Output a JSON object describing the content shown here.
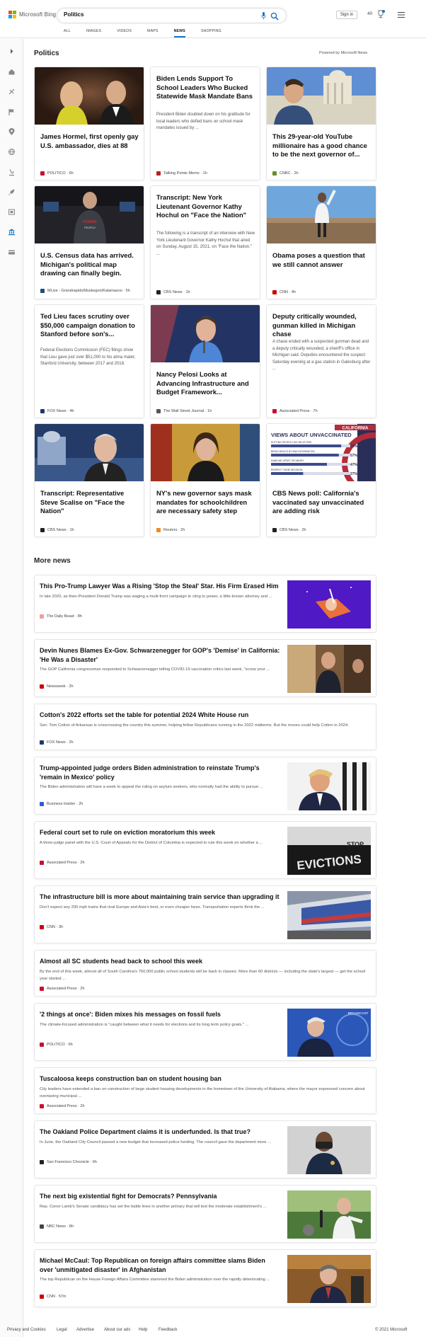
{
  "header": {
    "brand": "Microsoft Bing",
    "search_value": "Politics",
    "sign_in": "Sign in",
    "points": "40",
    "tabs": [
      {
        "label": "ALL"
      },
      {
        "label": "IMAGES"
      },
      {
        "label": "VIDEOS"
      },
      {
        "label": "MAPS"
      },
      {
        "label": "NEWS"
      },
      {
        "label": "SHOPPING"
      }
    ],
    "active_tab": "NEWS"
  },
  "colors": {
    "accent": "#1a73c9",
    "rail": "#fafafa",
    "border": "#e6e6e6"
  },
  "rail_icons": [
    "chevron-right-icon",
    "home-icon",
    "tools-icon",
    "flag-icon",
    "location-icon",
    "globe-icon",
    "microscope-icon",
    "rocket-icon",
    "film-icon",
    "bank-icon",
    "credit-card-icon"
  ],
  "politics": {
    "title": "Politics",
    "powered_by": "Powered by Microsoft News",
    "cards": [
      {
        "title": "James Hormel, first openly gay U.S. ambassador, dies at 88",
        "snippet": "",
        "source": "POLITICO",
        "age": "6h",
        "fav": "#c8102e"
      },
      {
        "title": "Biden Lends Support To School Leaders Who Bucked Statewide Mask Mandate Bans",
        "snippet": "President Biden doubled down on his gratitude for local leaders who defied bans on school mask mandates issued by ...",
        "source": "Talking Points Memo",
        "age": "1h",
        "fav": "#b22222"
      },
      {
        "title": "This 29-year-old YouTube millionaire has a good chance to be the next governor of...",
        "snippet": "",
        "source": "CNBC",
        "age": "2h",
        "fav": "#6b8e23"
      },
      {
        "title": "U.S. Census data has arrived. Michigan's political map drawing can finally begin.",
        "snippet": "",
        "source": "MLive - Grandrapids/Muskegon/Kalamazoo",
        "age": "5h",
        "fav": "#1f4e79"
      },
      {
        "title": "Transcript: New York Lieutenant Governor Kathy Hochul on \"Face the Nation\"",
        "snippet": "The following is a transcript of an interview with New York Lieutenant Governor Kathy Hochul that aired on Sunday, August 15, 2021, on \"Face the Nation.\" ...",
        "source": "CBS News",
        "age": "1h",
        "fav": "#222"
      },
      {
        "title": "Obama poses a question that we still cannot answer",
        "snippet": "",
        "source": "CNN",
        "age": "4h",
        "fav": "#cc0000"
      },
      {
        "title": "Ted Lieu faces scrutiny over $50,000 campaign donation to Stanford before son's...",
        "snippet": "Federal Elections Commission (FEC) filings show that Lieu gave just over $51,000 to his alma mater, Stanford University, between 2017 and 2018.",
        "source": "FOX News",
        "age": "4h",
        "fav": "#1b3a6b"
      },
      {
        "title": "Nancy Pelosi Looks at Advancing Infrastructure and Budget Framework...",
        "snippet": "",
        "source": "The Wall Street Journal",
        "age": "1h",
        "fav": "#555"
      },
      {
        "title": "Deputy critically wounded, gunman killed in Michigan chase",
        "snippet": "A chase ended with a suspected gunman dead and a deputy critically wounded, a sheriff's office in Michigan said. Deputies encountered the suspect Saturday evening at a gas station in Galesburg after ...",
        "source": "Associated Press",
        "age": "7h",
        "fav": "#c8102e"
      },
      {
        "title": "Transcript: Representative Steve Scalise on \"Face the Nation\"",
        "snippet": "",
        "source": "CBS News",
        "age": "1h",
        "fav": "#222"
      },
      {
        "title": "NY's new governor says mask mandates for schoolchildren are necessary safety step",
        "snippet": "",
        "source": "Reuters",
        "age": "2h",
        "fav": "#f08a24"
      },
      {
        "title": "CBS News poll: California's vaccinated say unvaccinated are adding risk",
        "snippet": "",
        "source": "CBS News",
        "age": "2h",
        "fav": "#222"
      }
    ],
    "poll_graphic": {
      "tag": "CALIFORNIA",
      "heading": "VIEWS ABOUT UNVACCINATED",
      "rows": [
        {
          "label": "PUTTING PEOPLE LIKE ME AT RISK",
          "value": "59%",
          "pct": 0.59
        },
        {
          "label": "BEING MISLED BY BAD INFORMATION",
          "value": "57%",
          "pct": 0.57
        },
        {
          "label": "HAND ME UPSET OR ANGRY",
          "value": "47%",
          "pct": 0.47
        },
        {
          "label": "RESPECT THEIR DECISION",
          "value": "27%",
          "pct": 0.27
        }
      ]
    }
  },
  "more_news": {
    "title": "More news",
    "items": [
      {
        "title": "This Pro-Trump Lawyer Was a Rising 'Stop the Steal' Star. His Firm Erased Him",
        "snippet": "In late 2020, as then-President Donald Trump was waging a multi-front campaign to cling to power, a little-known attorney and ...",
        "source": "The Daily Beast",
        "age": "8h",
        "fav": "#e9a0a0"
      },
      {
        "title": "Devin Nunes Blames Ex-Gov. Schwarzenegger for GOP's 'Demise' in California: 'He Was a Disaster'",
        "snippet": "The GOP California congressman responded to Schwarzenegger telling COVID-19 vaccination critics last week, \"screw your ...",
        "source": "Newsweek",
        "age": "2h",
        "fav": "#cc0000"
      },
      {
        "title": "Cotton's 2022 efforts set the table for potential 2024 White House run",
        "snippet": "Sen. Tom Cotton of Arkansas is crisscrossing the country this summer, helping fellow Republicans running in the 2022 midterms. But the moves could help Cotton in 2024.",
        "source": "FOX News",
        "age": "2h",
        "fav": "#1b3a6b"
      },
      {
        "title": "Trump-appointed judge orders Biden administration to reinstate Trump's 'remain in Mexico' policy",
        "snippet": "The Biden administration will have a week to appeal the ruling on asylum seekers, who normally had the ability to pursue ...",
        "source": "Business Insider",
        "age": "2h",
        "fav": "#2a5bd7"
      },
      {
        "title": "Federal court set to rule on eviction moratorium this week",
        "snippet": "A three-judge panel with the U.S. Court of Appeals for the District of Columbia is expected to rule this week on whether a ...",
        "source": "Associated Press",
        "age": "2h",
        "fav": "#c8102e"
      },
      {
        "title": "The infrastructure bill is more about maintaining train service than upgrading it",
        "snippet": "Don't expect any 200 mph trains that rival Europe and Asia's best, or even cheaper fares. Transportation experts think the ...",
        "source": "CNN",
        "age": "3h",
        "fav": "#cc0000"
      },
      {
        "title": "Almost all SC students head back to school this week",
        "snippet": "By the end of this week, almost all of South Carolina's 760,000 public school students will be back in classes. More than 60 districts — including the state's largest — get the school year started ...",
        "source": "Associated Press",
        "age": "2h",
        "fav": "#c8102e"
      },
      {
        "title": "'2 things at once': Biden mixes his messages on fossil fuels",
        "snippet": "The climate-focused administration is \"caught between what it needs for elections and its long term policy goals.\" ...",
        "source": "POLITICO",
        "age": "6h",
        "fav": "#c8102e"
      },
      {
        "title": "Tuscaloosa keeps construction ban on student housing ban",
        "snippet": "City leaders have extended a ban on construction of large student housing developments in the hometown of the University of Alabama, where the mayor expressed concern about overtaxing municipal ...",
        "source": "Associated Press",
        "age": "2h",
        "fav": "#c8102e"
      },
      {
        "title": "The Oakland Police Department claims it is underfunded. Is that true?",
        "snippet": "In June, the Oakland City Council passed a new budget that increased police funding. The council gave the department more ...",
        "source": "San Francisco Chronicle",
        "age": "6h",
        "fav": "#222"
      },
      {
        "title": "The next big existential fight for Democrats? Pennsylvania",
        "snippet": "Rep. Conor Lamb's Senate candidacy has set the battle lines in another primary that will test the moderate establishment's ...",
        "source": "NBC News",
        "age": "8h",
        "fav": "#444"
      },
      {
        "title": "Michael McCaul: Top Republican on foreign affairs committee slams Biden over 'unmitigated disaster' in Afghanistan",
        "snippet": "The top Republican on the House Foreign Affairs Committee slammed the Biden administration over the rapidly deteriorating ...",
        "source": "CNN",
        "age": "57m",
        "fav": "#cc0000"
      }
    ],
    "image_texts": {
      "broadcast": "BROADCAST",
      "evictions": "EVICTIONS",
      "stop": "STOP"
    }
  },
  "footer": {
    "links": [
      "Privacy and Cookies",
      "Legal",
      "Advertise",
      "About our ads",
      "Help",
      "Feedback"
    ],
    "copyright": "© 2021 Microsoft"
  }
}
